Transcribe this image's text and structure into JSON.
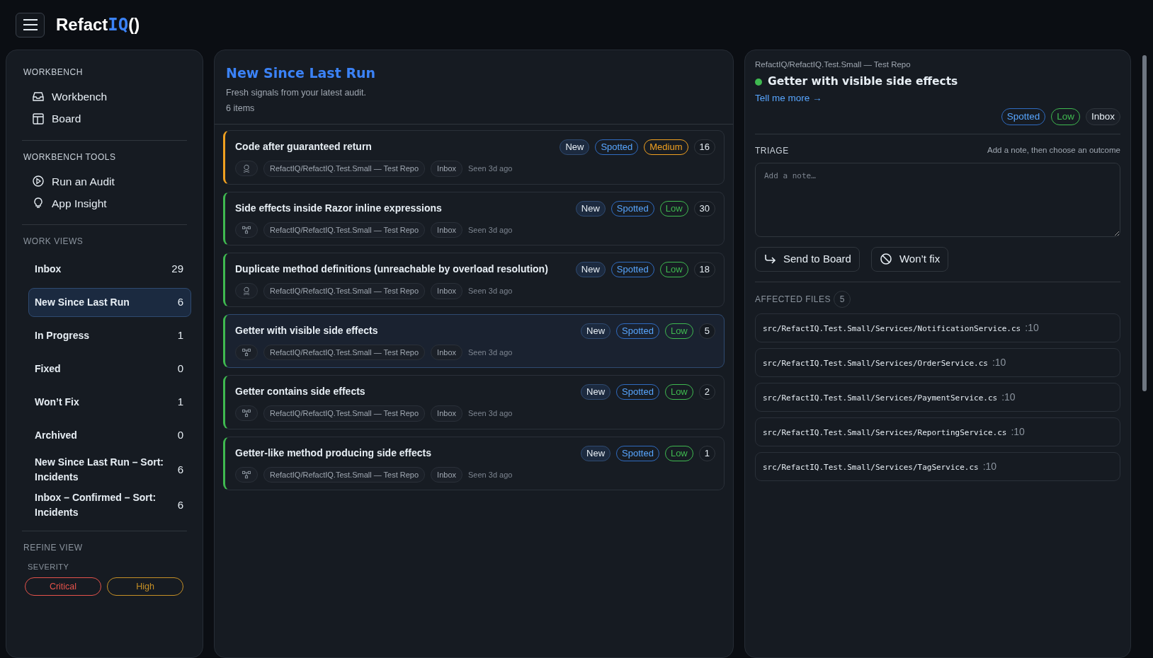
{
  "app": {
    "logo_main": "Refact",
    "logo_accent": "IQ",
    "logo_tail": "()"
  },
  "sidebar": {
    "sections": [
      {
        "title": "WORKBENCH",
        "kind": "links",
        "items": [
          {
            "label": "Workbench",
            "kind": "inbox"
          },
          {
            "label": "Board",
            "kind": "board"
          }
        ]
      },
      {
        "title": "WORKBENCH TOOLS",
        "kind": "links",
        "items": [
          {
            "label": "Run an Audit",
            "kind": "play"
          },
          {
            "label": "App Insight",
            "kind": "bulb"
          }
        ]
      },
      {
        "title": "WORK VIEWS",
        "kind": "views",
        "items": [
          {
            "label": "Inbox",
            "count": "29",
            "selected": false
          },
          {
            "label": "New Since Last Run",
            "count": "6",
            "selected": true
          },
          {
            "label": "In Progress",
            "count": "1",
            "selected": false
          },
          {
            "label": "Fixed",
            "count": "0",
            "selected": false
          },
          {
            "label": "Won’t Fix",
            "count": "1",
            "selected": false
          },
          {
            "label": "Archived",
            "count": "0",
            "selected": false
          },
          {
            "label": "New Since Last Run – Sort: Incidents",
            "count": "6",
            "selected": false
          },
          {
            "label": "Inbox – Confirmed – Sort: Incidents",
            "count": "6",
            "selected": false
          }
        ]
      }
    ],
    "refine": {
      "title": "REFINE VIEW",
      "subtitle": "SEVERITY",
      "chips": [
        {
          "label": "Critical",
          "color": "#e5534b"
        },
        {
          "label": "High",
          "color": "#c69026"
        }
      ]
    }
  },
  "list": {
    "title": "New Since Last Run",
    "subtitle": "Fresh signals from your latest audit.",
    "count": "6 items",
    "items": [
      {
        "title": "Code after guaranteed return",
        "kind": "skull",
        "badges": [
          "New",
          "Spotted"
        ],
        "severity": "Medium",
        "color": "#f0a020",
        "count": "16",
        "repo": "RefactIQ/RefactIQ.Test.Small — Test Repo",
        "stage": "Inbox",
        "seen": "Seen 3d ago",
        "selected": false
      },
      {
        "title": "Side effects inside Razor inline expressions",
        "kind": "tree",
        "badges": [
          "New",
          "Spotted"
        ],
        "severity": "Low",
        "color": "#3fb950",
        "count": "30",
        "repo": "RefactIQ/RefactIQ.Test.Small — Test Repo",
        "stage": "Inbox",
        "seen": "Seen 3d ago",
        "selected": false
      },
      {
        "title": "Duplicate method definitions (unreachable by overload resolution)",
        "kind": "skull",
        "badges": [
          "New",
          "Spotted"
        ],
        "severity": "Low",
        "color": "#3fb950",
        "count": "18",
        "repo": "RefactIQ/RefactIQ.Test.Small — Test Repo",
        "stage": "Inbox",
        "seen": "Seen 3d ago",
        "selected": false
      },
      {
        "title": "Getter with visible side effects",
        "kind": "tree",
        "badges": [
          "New",
          "Spotted"
        ],
        "severity": "Low",
        "color": "#3fb950",
        "count": "5",
        "repo": "RefactIQ/RefactIQ.Test.Small — Test Repo",
        "stage": "Inbox",
        "seen": "Seen 3d ago",
        "selected": true
      },
      {
        "title": "Getter contains side effects",
        "kind": "tree",
        "badges": [
          "New",
          "Spotted"
        ],
        "severity": "Low",
        "color": "#3fb950",
        "count": "2",
        "repo": "RefactIQ/RefactIQ.Test.Small — Test Repo",
        "stage": "Inbox",
        "seen": "Seen 3d ago",
        "selected": false
      },
      {
        "title": "Getter-like method producing side effects",
        "kind": "tree",
        "badges": [
          "New",
          "Spotted"
        ],
        "severity": "Low",
        "color": "#3fb950",
        "count": "1",
        "repo": "RefactIQ/RefactIQ.Test.Small — Test Repo",
        "stage": "Inbox",
        "seen": "Seen 3d ago",
        "selected": false
      }
    ]
  },
  "detail": {
    "repo": "RefactIQ/RefactIQ.Test.Small — Test Repo",
    "title": "Getter with visible side effects",
    "color": "#3fb950",
    "link": "Tell me more →",
    "tags": [
      {
        "label": "Spotted",
        "kind": "status"
      },
      {
        "label": "Low",
        "kind": "severity"
      },
      {
        "label": "Inbox",
        "kind": "stage"
      }
    ],
    "triage": {
      "title": "TRIAGE",
      "hint": "Add a note, then choose an outcome",
      "placeholder": "Add a note…",
      "buttons": [
        {
          "label": "Send to Board",
          "kind": "send"
        },
        {
          "label": "Won’t fix",
          "kind": "ban"
        }
      ]
    },
    "files": {
      "title": "AFFECTED FILES",
      "count": "5",
      "items": [
        {
          "path": "src/RefactIQ.Test.Small/Services/NotificationService.cs",
          "line": ":10"
        },
        {
          "path": "src/RefactIQ.Test.Small/Services/OrderService.cs",
          "line": ":10"
        },
        {
          "path": "src/RefactIQ.Test.Small/Services/PaymentService.cs",
          "line": ":10"
        },
        {
          "path": "src/RefactIQ.Test.Small/Services/ReportingService.cs",
          "line": ":10"
        },
        {
          "path": "src/RefactIQ.Test.Small/Services/TagService.cs",
          "line": ":10"
        }
      ]
    }
  }
}
